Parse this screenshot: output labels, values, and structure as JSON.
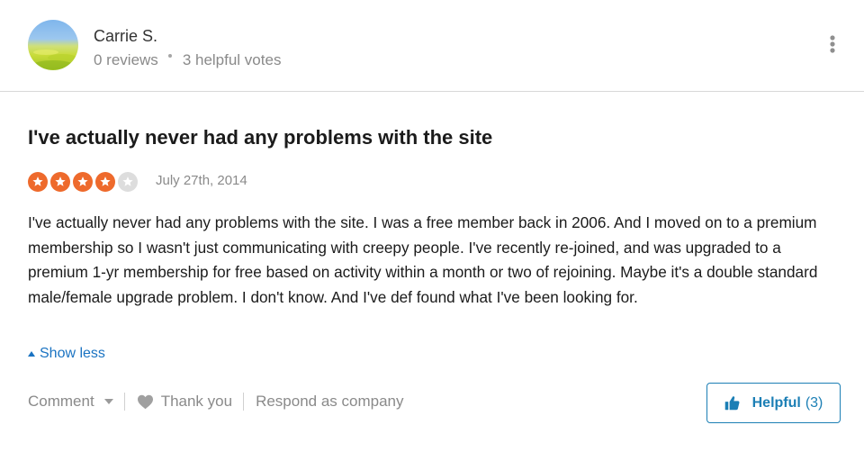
{
  "reviewer": {
    "name": "Carrie S.",
    "reviews": "0 reviews",
    "helpful_votes": "3 helpful votes"
  },
  "review": {
    "title": "I've actually never had any problems with the site",
    "rating": 4,
    "rating_max": 5,
    "date": "July 27th, 2014",
    "body": "I've actually never had any problems with the site. I was a free member back in 2006. And I moved on to a premium membership so I wasn't just communicating with creepy people. I've recently re-joined, and was upgraded to a premium 1-yr membership for free based on activity within a month or two of rejoining. Maybe it's a double standard male/female upgrade problem. I don't know. And I've def found what I've been looking for.",
    "show_less_label": "Show less"
  },
  "actions": {
    "comment_label": "Comment",
    "thank_you_label": "Thank you",
    "respond_label": "Respond as company",
    "helpful_label": "Helpful",
    "helpful_count": "(3)"
  },
  "colors": {
    "star_filled": "#ee6a2c",
    "star_empty": "#dddddd",
    "link": "#1a73c2",
    "helpful_accent": "#1c7fb5"
  },
  "icons": {
    "more": "more-vertical-icon",
    "heart": "heart-icon",
    "thumb": "thumbs-up-icon",
    "star": "star-icon",
    "caret": "caret-up-icon",
    "chevron": "chevron-down-icon"
  }
}
